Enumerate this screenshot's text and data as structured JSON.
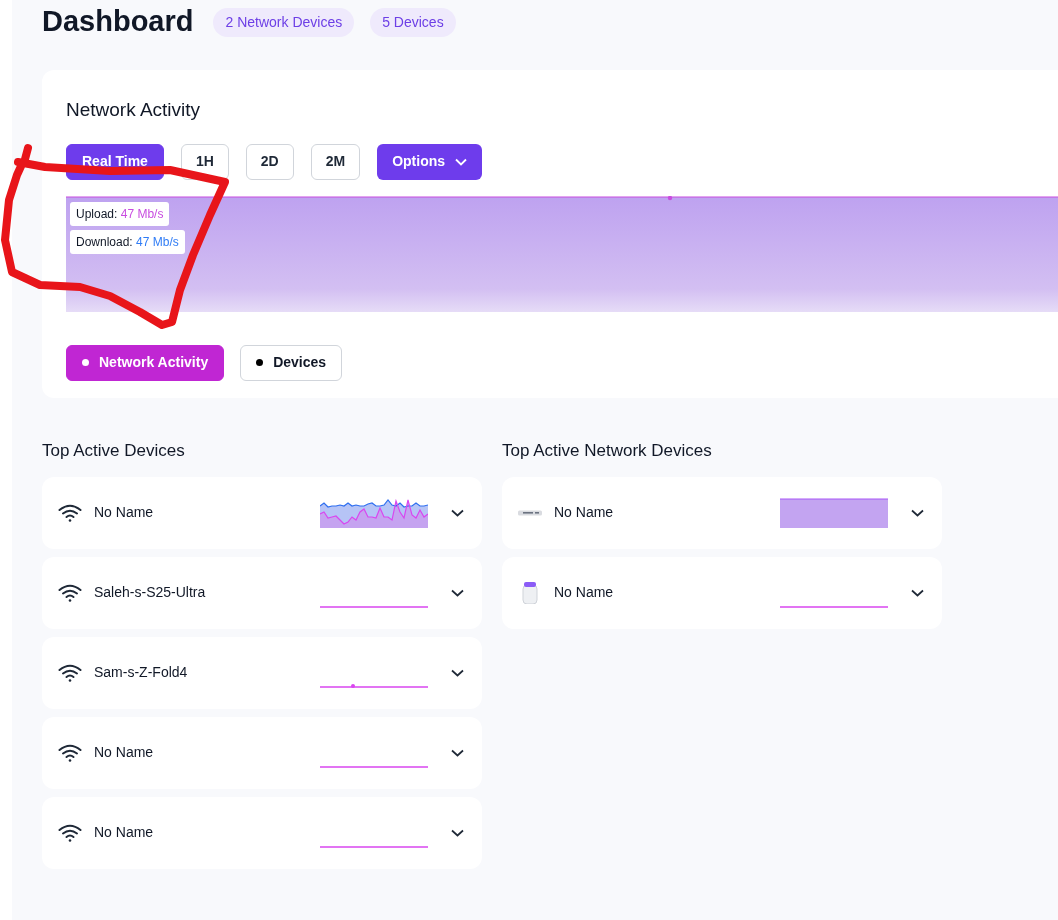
{
  "header": {
    "title": "Dashboard",
    "badges": [
      "2 Network Devices",
      "5 Devices"
    ]
  },
  "network_activity": {
    "title": "Network Activity",
    "ranges": [
      {
        "label": "Real Time",
        "selected": true
      },
      {
        "label": "1H",
        "selected": false
      },
      {
        "label": "2D",
        "selected": false
      },
      {
        "label": "2M",
        "selected": false
      }
    ],
    "options_button": "Options",
    "tooltip": [
      {
        "label": "Upload:",
        "value": "47 Mb/s",
        "kind": "upload"
      },
      {
        "label": "Download:",
        "value": "47 Mb/s",
        "kind": "download"
      }
    ],
    "legend": [
      {
        "label": "Network Activity",
        "selected": true
      },
      {
        "label": "Devices",
        "selected": false
      }
    ]
  },
  "top_active_devices": {
    "title": "Top Active Devices",
    "items": [
      {
        "name": "No Name",
        "kind": "wifi",
        "sparkline": {
          "kind": "busy"
        }
      },
      {
        "name": "Saleh-s-S25-Ultra",
        "kind": "wifi",
        "sparkline": {
          "kind": "flat"
        }
      },
      {
        "name": "Sam-s-Z-Fold4",
        "kind": "wifi",
        "sparkline": {
          "kind": "flat_dot"
        }
      },
      {
        "name": "No Name",
        "kind": "wifi",
        "sparkline": {
          "kind": "flat"
        }
      },
      {
        "name": "No Name",
        "kind": "wifi",
        "sparkline": {
          "kind": "flat"
        }
      }
    ]
  },
  "top_active_network_devices": {
    "title": "Top Active Network Devices",
    "items": [
      {
        "name": "No Name",
        "kind": "switch",
        "sparkline": {
          "kind": "filled"
        }
      },
      {
        "name": "No Name",
        "kind": "access_point",
        "sparkline": {
          "kind": "flat"
        }
      }
    ]
  },
  "annotation": {
    "kind": "freehand_loop"
  }
}
